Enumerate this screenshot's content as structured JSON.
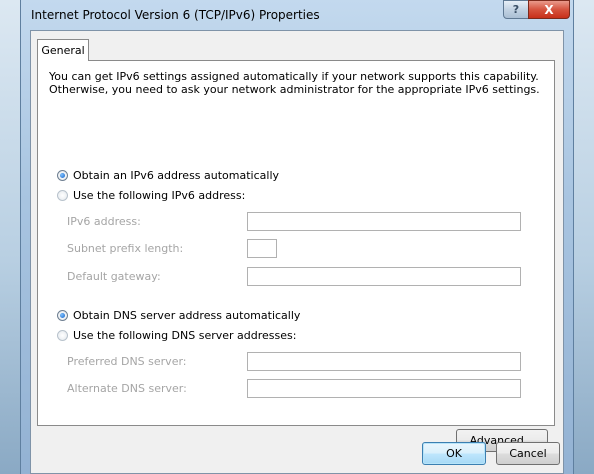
{
  "window": {
    "title": "Internet Protocol Version 6 (TCP/IPv6) Properties",
    "help_glyph": "?",
    "close_glyph": "X"
  },
  "tabs": [
    {
      "label": "General",
      "selected": true
    }
  ],
  "description": [
    "You can get IPv6 settings assigned automatically if your network supports this capability.",
    "Otherwise, you need to ask your network administrator for the appropriate IPv6 settings."
  ],
  "address": {
    "auto_label": "Obtain an IPv6 address automatically",
    "auto_selected": true,
    "manual_label": "Use the following IPv6 address:",
    "fields": [
      {
        "label": "IPv6 address:",
        "value": ""
      },
      {
        "label": "Subnet prefix length:",
        "value": ""
      },
      {
        "label": "Default gateway:",
        "value": ""
      }
    ]
  },
  "dns": {
    "auto_label": "Obtain DNS server address automatically",
    "auto_selected": true,
    "manual_label": "Use the following DNS server addresses:",
    "fields": [
      {
        "label": "Preferred DNS server:",
        "value": ""
      },
      {
        "label": "Alternate DNS server:",
        "value": ""
      }
    ]
  },
  "buttons": {
    "advanced": "Advanced...",
    "ok": "OK",
    "cancel": "Cancel"
  },
  "colors": {
    "title_bar": "#a9c5e1",
    "close_button": "#c7301a",
    "radio_selected": "#1561c8",
    "disabled_text": "#a5a5a5"
  }
}
